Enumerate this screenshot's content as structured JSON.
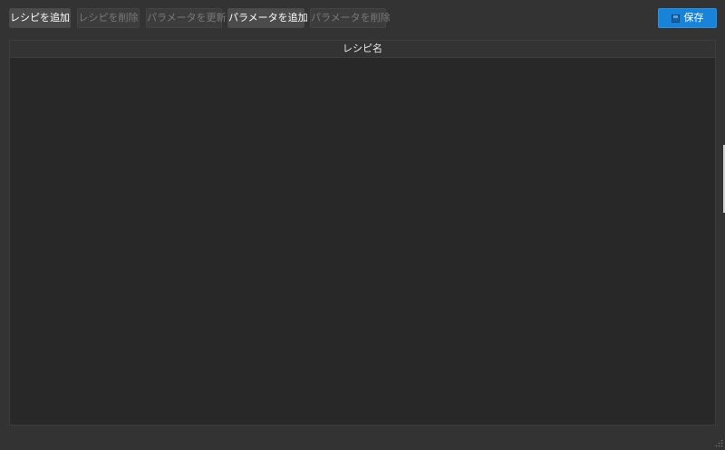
{
  "toolbar": {
    "add_recipe": "レシピを追加",
    "delete_recipe": "レシピを削除",
    "update_parameter": "パラメータを更新",
    "add_parameter": "パラメータを追加",
    "delete_parameter": "パラメータを削除",
    "save": "保存"
  },
  "table": {
    "columns": [
      "レシピ名"
    ],
    "rows": []
  },
  "colors": {
    "background": "#333333",
    "table_background": "#282828",
    "accent": "#1883d7"
  },
  "icons": {
    "save": "save-icon",
    "grip": "size-grip-icon"
  }
}
